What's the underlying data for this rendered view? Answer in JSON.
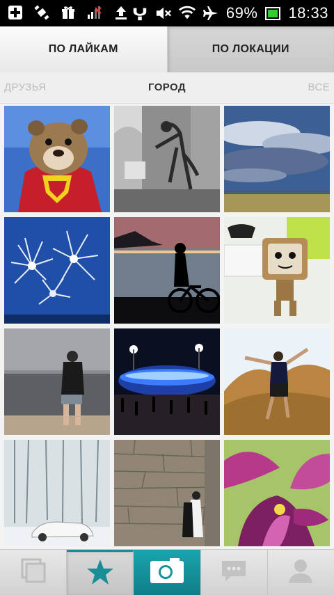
{
  "status_bar": {
    "battery": "69%",
    "time": "18:33"
  },
  "tabs": [
    {
      "label": "ПО ЛАЙКАМ",
      "active": true
    },
    {
      "label": "ПО ЛОКАЦИИ",
      "active": false
    }
  ],
  "scope": {
    "left": "ДРУЗЬЯ",
    "center": "ГОРОД",
    "right": "ВСЕ"
  },
  "photos": [
    {
      "name": "bear-superman"
    },
    {
      "name": "dinosaur-skeleton-museum"
    },
    {
      "name": "cloudy-sky-field"
    },
    {
      "name": "fireworks"
    },
    {
      "name": "cyclist-sunset-sea"
    },
    {
      "name": "sackboy-toy"
    },
    {
      "name": "couple-beach"
    },
    {
      "name": "stadium-night"
    },
    {
      "name": "jumping-man-hills"
    },
    {
      "name": "snowy-forest-car"
    },
    {
      "name": "wedding-stone-wall"
    },
    {
      "name": "purple-flowers"
    }
  ],
  "bottom_nav": [
    {
      "icon": "gallery-icon"
    },
    {
      "icon": "star-icon"
    },
    {
      "icon": "camera-icon"
    },
    {
      "icon": "chat-icon"
    },
    {
      "icon": "profile-icon"
    }
  ],
  "colors": {
    "accent": "#1b8d96",
    "camera_bg": "#1aa4ae"
  }
}
